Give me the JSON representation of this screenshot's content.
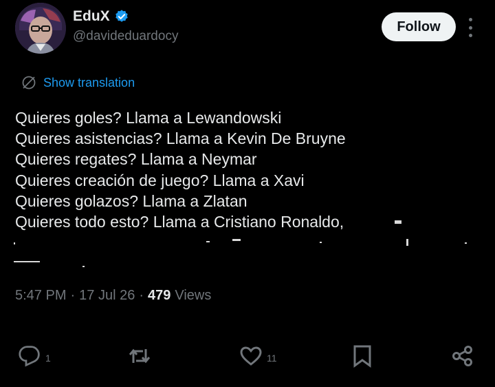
{
  "author": {
    "display_name": "EduX",
    "handle": "@davideduardocy",
    "verified": true
  },
  "follow_label": "Follow",
  "translation_label": "Show translation",
  "tweet_lines": [
    "Quieres goles? Llama a Lewandowski",
    "Quieres asistencias? Llama a Kevin De Bruyne",
    "Quieres regates? Llama a Neymar",
    "Quieres creación de juego? Llama a Xavi",
    "Quieres golazos? Llama a Zlatan",
    "Quieres todo esto? Llama a Cristiano Ronaldo,"
  ],
  "meta": {
    "time": "5:47 PM",
    "date": "17 Jul 26",
    "separator": "·",
    "views_count": "479",
    "views_label": "Views"
  },
  "actions": {
    "reply_count": "1",
    "repost_count": "",
    "like_count": "11"
  },
  "colors": {
    "background": "#000000",
    "text": "#e7e9ea",
    "muted": "#71767b",
    "link": "#1d9bf0",
    "verified": "#1d9bf0"
  },
  "icons": [
    "verified-badge-icon",
    "more-icon",
    "translate-icon",
    "reply-icon",
    "repost-icon",
    "like-icon",
    "bookmark-icon",
    "share-icon"
  ]
}
